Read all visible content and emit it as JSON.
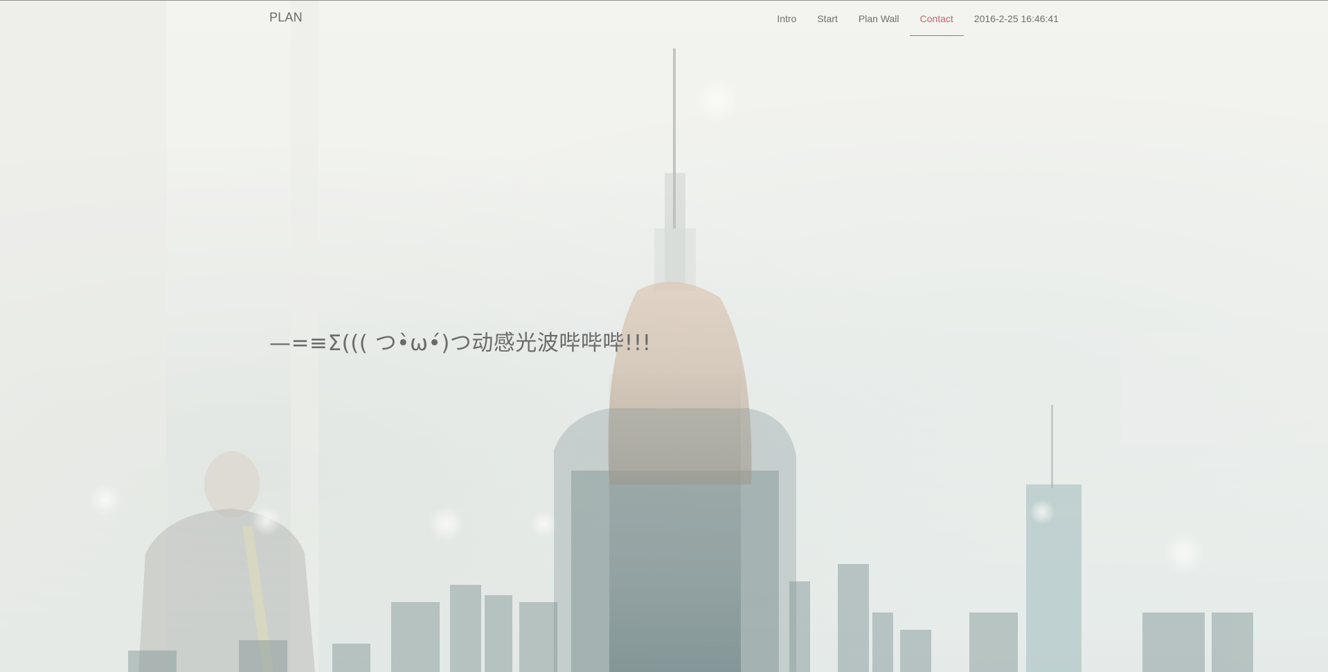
{
  "brand": "PLAN",
  "nav": {
    "items": [
      {
        "label": "Intro",
        "active": false
      },
      {
        "label": "Start",
        "active": false
      },
      {
        "label": "Plan Wall",
        "active": false
      },
      {
        "label": "Contact",
        "active": true
      }
    ],
    "datetime": "2016-2-25 16:46:41"
  },
  "hero": {
    "text": "—=≡Σ((( つ•̀ω•́)つ动感光波哔哔哔!!!"
  },
  "colors": {
    "accent": "#c0676b",
    "text": "#6d6d6d"
  }
}
